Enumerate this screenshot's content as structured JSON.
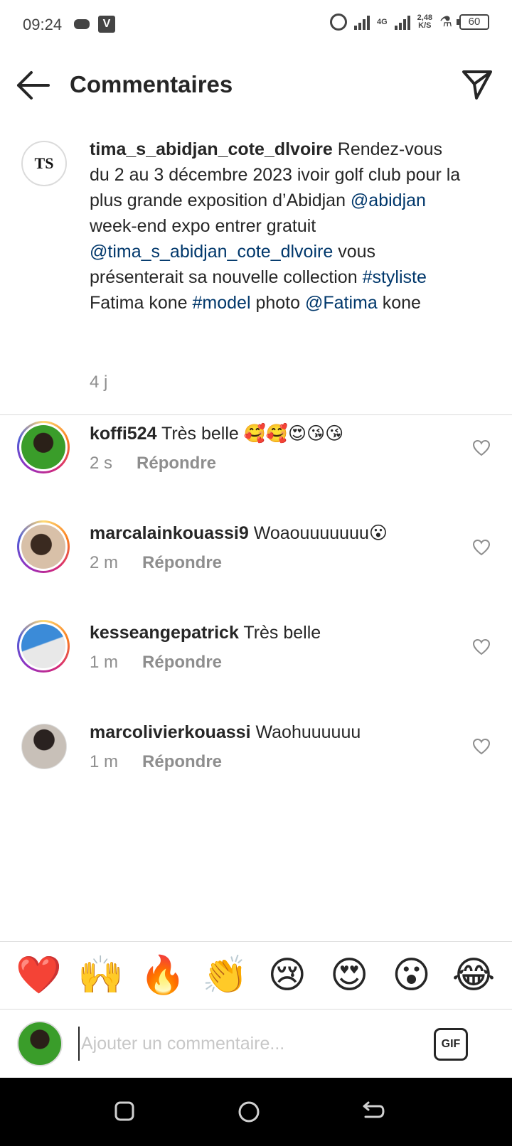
{
  "status_bar": {
    "time": "09:24",
    "network_label": "4G",
    "speed_value": "2,48",
    "speed_unit": "K/S",
    "battery": "60"
  },
  "header": {
    "title": "Commentaires"
  },
  "caption": {
    "avatar_text": "TS",
    "username": "tima_s_abidjan_cote_dlvoire",
    "text_1": " Rendez-vous du 2 au 3 décembre 2023 ivoir golf club pour la plus grande exposition d’Abidjan ",
    "mention_1": "@abidjan",
    "text_2": " week-end expo entrer gratuit ",
    "mention_2": "@tima_s_abidjan_cote_dlvoire",
    "text_3": " vous présenterait sa nouvelle collection ",
    "hashtag_1": "#styliste",
    "text_4": " Fatima kone ",
    "hashtag_2": "#model",
    "text_5": " photo ",
    "mention_3": "@Fatima",
    "text_6": " kone",
    "time": "4 j"
  },
  "comments": [
    {
      "username": "koffi524",
      "text": "Très belle 🥰🥰😍😘😘",
      "time": "2 s",
      "reply_label": "Répondre",
      "avatar_color": "#3a9d2a"
    },
    {
      "username": "marcalainkouassi9",
      "text": "Woaouuuuuuu😮",
      "time": "2 m",
      "reply_label": "Répondre",
      "avatar_color": "#b98c6a"
    },
    {
      "username": "kesseangepatrick",
      "text": "Très belle",
      "time": "1 m",
      "reply_label": "Répondre",
      "avatar_color": "#3b8bd8"
    },
    {
      "username": "marcolivierkouassi",
      "text": "Waohuuuuuu",
      "time": "1 m",
      "reply_label": "Répondre",
      "avatar_color": "#8a7a6e"
    }
  ],
  "emoji_bar": [
    "❤️",
    "🙌",
    "🔥",
    "👏",
    "😢",
    "😍",
    "😮",
    "😂"
  ],
  "input": {
    "placeholder": "Ajouter un commentaire...",
    "gif_label": "GIF"
  },
  "colors": {
    "link": "#00376b",
    "muted": "#8e8e8e",
    "text": "#262626"
  }
}
